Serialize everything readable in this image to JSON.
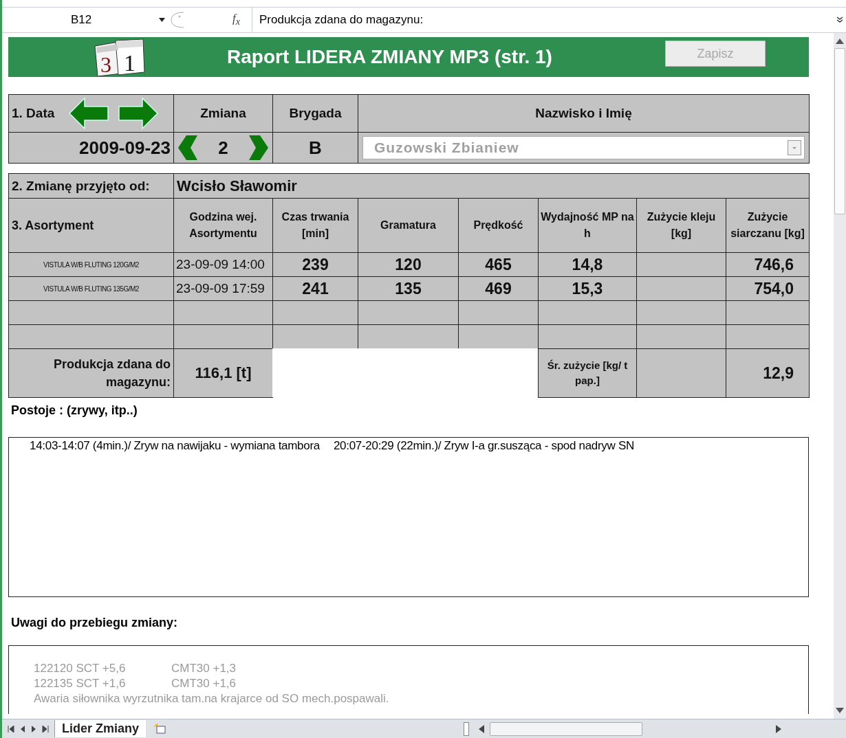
{
  "formula_bar": {
    "cell_ref": "B12",
    "fx": "f$_{x}$",
    "content": "Produkcja zdana do magazynu:"
  },
  "header": {
    "logo_digits": [
      "3",
      "1"
    ],
    "title": "Raport LIDERA ZMIANY MP3 (str. 1)",
    "save_button": {
      "label": "Zapisz",
      "disabled": true
    }
  },
  "shift_info": {
    "date_label": "1. Data",
    "shift_label": "Zmiana",
    "brigade_label": "Brygada",
    "name_label": "Nazwisko i Imię",
    "date": "2009-09-23",
    "shift": "2",
    "brigade": "B",
    "name": {
      "value": "Guzowski Zbianiew",
      "disabled": true
    }
  },
  "handover": {
    "label": "2. Zmianę przyjęto od:",
    "value": "Wcisło Sławomir"
  },
  "table": {
    "columns": [
      "3. Asortyment",
      "Godzina wej. Asortymentu",
      "Czas trwania [min]",
      "Gramatura",
      "Prędkość",
      "Wydajność MP na h",
      "Zużycie kleju [kg]",
      "Zużycie siarczanu [kg]"
    ],
    "rows": [
      {
        "product": "VISTULA W/B FLUTING 120G/M2",
        "start": "23-09-09 14:00",
        "duration": "239",
        "grammage": "120",
        "speed": "465",
        "efficiency": "14,8",
        "sulfate": "746,6"
      },
      {
        "product": "VISTULA W/B FLUTING 135G/M2",
        "start": "23-09-09 17:59",
        "duration": "241",
        "grammage": "135",
        "speed": "469",
        "efficiency": "15,3",
        "sulfate": "754,0"
      },
      {},
      {}
    ]
  },
  "summary": {
    "production_label": "Produkcja zdana do magazynu:",
    "production_value": "116,1 [t]",
    "avg_label": "Śr. zużycie [kg/ t pap.]",
    "avg_sulfate": "12,9"
  },
  "downtime": {
    "label": "Postoje : (zrywy, itp..)",
    "entries": [
      "14:03-14:07 (4min.)/ Zryw na nawijaku - wymiana tambora",
      "20:07-20:29 (22min.)/ Zryw I-a gr.susząca - spod nadryw SN"
    ]
  },
  "notes": {
    "label": "Uwagi do przebiegu zmiany:",
    "lines": [
      [
        "122120 SCT +5,6",
        "CMT30 +1,3"
      ],
      [
        "122135 SCT +1,6",
        "CMT30 +1,6"
      ],
      [
        "Awaria siłownika wyrzutnika tam.na krajarce od SO mech.pospawali."
      ]
    ]
  },
  "sheet_tabs": [
    {
      "label": "Lider Zmiany",
      "selected": true
    }
  ]
}
